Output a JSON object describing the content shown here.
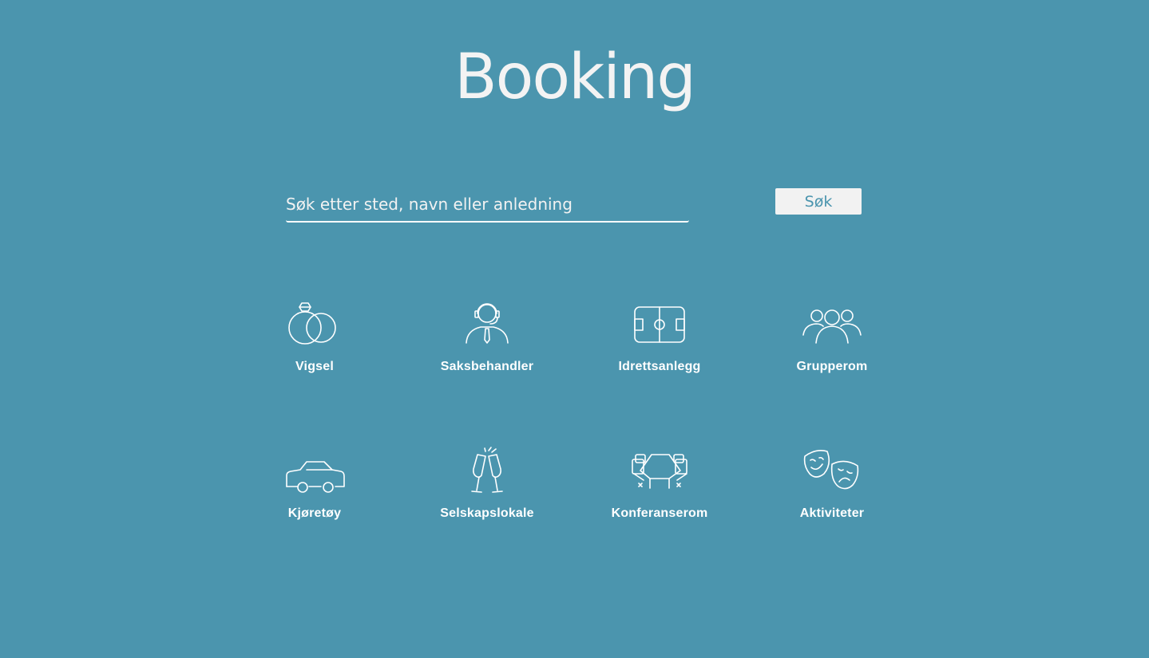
{
  "header": {
    "title": "Booking"
  },
  "search": {
    "placeholder": "Søk etter sted, navn eller anledning",
    "value": "",
    "button_label": "Søk"
  },
  "categories": [
    {
      "label": "Vigsel",
      "icon": "wedding-rings-icon"
    },
    {
      "label": "Saksbehandler",
      "icon": "case-officer-headset-icon"
    },
    {
      "label": "Idrettsanlegg",
      "icon": "sports-field-icon"
    },
    {
      "label": "Grupperom",
      "icon": "group-people-icon"
    },
    {
      "label": "Kjøretøy",
      "icon": "car-icon"
    },
    {
      "label": "Selskapslokale",
      "icon": "champagne-toast-icon"
    },
    {
      "label": "Konferanserom",
      "icon": "conference-table-icon"
    },
    {
      "label": "Aktiviteter",
      "icon": "theater-masks-icon"
    }
  ],
  "colors": {
    "background": "#4b95ae",
    "foreground": "#ffffff",
    "button_background": "#f2f2f2",
    "button_text": "#4b95ae"
  }
}
